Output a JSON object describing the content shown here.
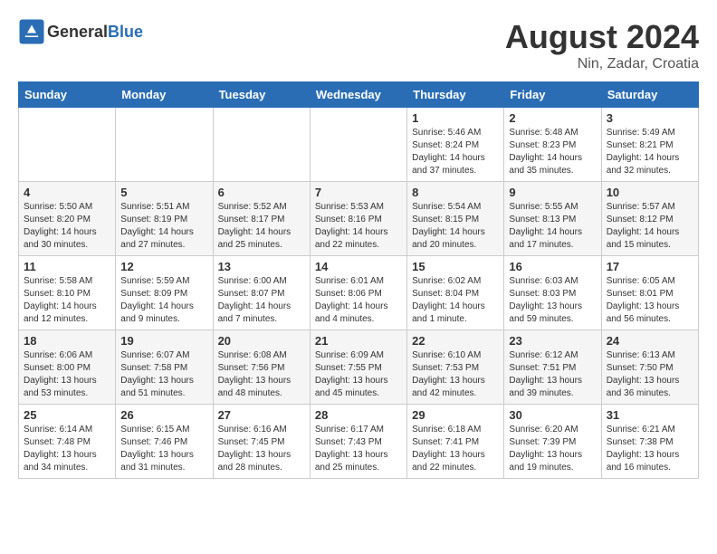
{
  "header": {
    "logo_general": "General",
    "logo_blue": "Blue",
    "month_year": "August 2024",
    "location": "Nin, Zadar, Croatia"
  },
  "days_of_week": [
    "Sunday",
    "Monday",
    "Tuesday",
    "Wednesday",
    "Thursday",
    "Friday",
    "Saturday"
  ],
  "weeks": [
    [
      {
        "day": "",
        "info": ""
      },
      {
        "day": "",
        "info": ""
      },
      {
        "day": "",
        "info": ""
      },
      {
        "day": "",
        "info": ""
      },
      {
        "day": "1",
        "info": "Sunrise: 5:46 AM\nSunset: 8:24 PM\nDaylight: 14 hours\nand 37 minutes."
      },
      {
        "day": "2",
        "info": "Sunrise: 5:48 AM\nSunset: 8:23 PM\nDaylight: 14 hours\nand 35 minutes."
      },
      {
        "day": "3",
        "info": "Sunrise: 5:49 AM\nSunset: 8:21 PM\nDaylight: 14 hours\nand 32 minutes."
      }
    ],
    [
      {
        "day": "4",
        "info": "Sunrise: 5:50 AM\nSunset: 8:20 PM\nDaylight: 14 hours\nand 30 minutes."
      },
      {
        "day": "5",
        "info": "Sunrise: 5:51 AM\nSunset: 8:19 PM\nDaylight: 14 hours\nand 27 minutes."
      },
      {
        "day": "6",
        "info": "Sunrise: 5:52 AM\nSunset: 8:17 PM\nDaylight: 14 hours\nand 25 minutes."
      },
      {
        "day": "7",
        "info": "Sunrise: 5:53 AM\nSunset: 8:16 PM\nDaylight: 14 hours\nand 22 minutes."
      },
      {
        "day": "8",
        "info": "Sunrise: 5:54 AM\nSunset: 8:15 PM\nDaylight: 14 hours\nand 20 minutes."
      },
      {
        "day": "9",
        "info": "Sunrise: 5:55 AM\nSunset: 8:13 PM\nDaylight: 14 hours\nand 17 minutes."
      },
      {
        "day": "10",
        "info": "Sunrise: 5:57 AM\nSunset: 8:12 PM\nDaylight: 14 hours\nand 15 minutes."
      }
    ],
    [
      {
        "day": "11",
        "info": "Sunrise: 5:58 AM\nSunset: 8:10 PM\nDaylight: 14 hours\nand 12 minutes."
      },
      {
        "day": "12",
        "info": "Sunrise: 5:59 AM\nSunset: 8:09 PM\nDaylight: 14 hours\nand 9 minutes."
      },
      {
        "day": "13",
        "info": "Sunrise: 6:00 AM\nSunset: 8:07 PM\nDaylight: 14 hours\nand 7 minutes."
      },
      {
        "day": "14",
        "info": "Sunrise: 6:01 AM\nSunset: 8:06 PM\nDaylight: 14 hours\nand 4 minutes."
      },
      {
        "day": "15",
        "info": "Sunrise: 6:02 AM\nSunset: 8:04 PM\nDaylight: 14 hours\nand 1 minute."
      },
      {
        "day": "16",
        "info": "Sunrise: 6:03 AM\nSunset: 8:03 PM\nDaylight: 13 hours\nand 59 minutes."
      },
      {
        "day": "17",
        "info": "Sunrise: 6:05 AM\nSunset: 8:01 PM\nDaylight: 13 hours\nand 56 minutes."
      }
    ],
    [
      {
        "day": "18",
        "info": "Sunrise: 6:06 AM\nSunset: 8:00 PM\nDaylight: 13 hours\nand 53 minutes."
      },
      {
        "day": "19",
        "info": "Sunrise: 6:07 AM\nSunset: 7:58 PM\nDaylight: 13 hours\nand 51 minutes."
      },
      {
        "day": "20",
        "info": "Sunrise: 6:08 AM\nSunset: 7:56 PM\nDaylight: 13 hours\nand 48 minutes."
      },
      {
        "day": "21",
        "info": "Sunrise: 6:09 AM\nSunset: 7:55 PM\nDaylight: 13 hours\nand 45 minutes."
      },
      {
        "day": "22",
        "info": "Sunrise: 6:10 AM\nSunset: 7:53 PM\nDaylight: 13 hours\nand 42 minutes."
      },
      {
        "day": "23",
        "info": "Sunrise: 6:12 AM\nSunset: 7:51 PM\nDaylight: 13 hours\nand 39 minutes."
      },
      {
        "day": "24",
        "info": "Sunrise: 6:13 AM\nSunset: 7:50 PM\nDaylight: 13 hours\nand 36 minutes."
      }
    ],
    [
      {
        "day": "25",
        "info": "Sunrise: 6:14 AM\nSunset: 7:48 PM\nDaylight: 13 hours\nand 34 minutes."
      },
      {
        "day": "26",
        "info": "Sunrise: 6:15 AM\nSunset: 7:46 PM\nDaylight: 13 hours\nand 31 minutes."
      },
      {
        "day": "27",
        "info": "Sunrise: 6:16 AM\nSunset: 7:45 PM\nDaylight: 13 hours\nand 28 minutes."
      },
      {
        "day": "28",
        "info": "Sunrise: 6:17 AM\nSunset: 7:43 PM\nDaylight: 13 hours\nand 25 minutes."
      },
      {
        "day": "29",
        "info": "Sunrise: 6:18 AM\nSunset: 7:41 PM\nDaylight: 13 hours\nand 22 minutes."
      },
      {
        "day": "30",
        "info": "Sunrise: 6:20 AM\nSunset: 7:39 PM\nDaylight: 13 hours\nand 19 minutes."
      },
      {
        "day": "31",
        "info": "Sunrise: 6:21 AM\nSunset: 7:38 PM\nDaylight: 13 hours\nand 16 minutes."
      }
    ]
  ]
}
